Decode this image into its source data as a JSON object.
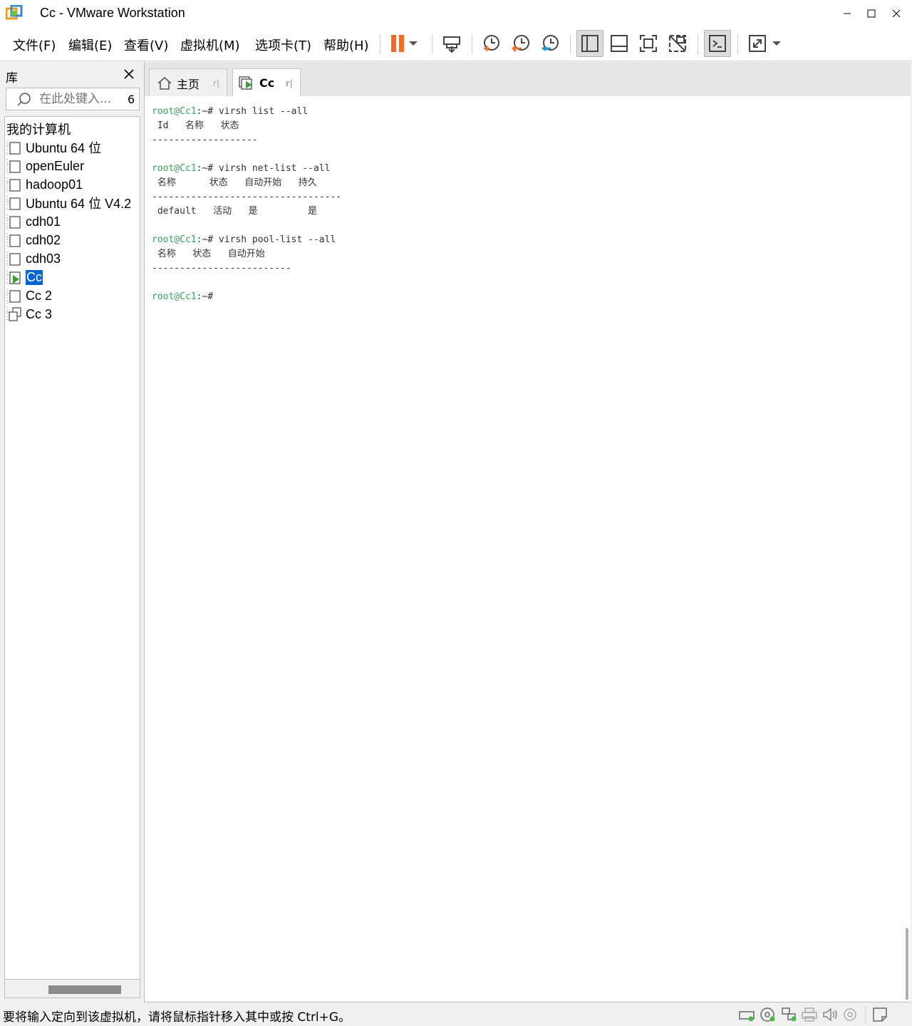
{
  "window": {
    "title": "Cc - VMware Workstation"
  },
  "menu": [
    "文件(F)",
    "编辑(E)",
    "查看(V)",
    "虚拟机(M)",
    "选项卡(T)",
    "帮助(H)"
  ],
  "toolbar": {
    "icons": [
      "pause-icon",
      "dropdown-icon",
      "send-ctrl-alt-del-icon",
      "snapshot-take-icon",
      "snapshot-revert-icon",
      "snapshot-manager-icon",
      "show-library-icon",
      "show-thumbnail-bar-icon",
      "fullscreen-icon",
      "unity-icon",
      "console-view-icon",
      "stretch-icon",
      "dropdown-icon"
    ],
    "accent_pause": "#ef6c25"
  },
  "library": {
    "title": "库",
    "search_placeholder": "在此处键入...",
    "search_badge": "6",
    "root": "我的计算机",
    "items": [
      {
        "label": "Ubuntu 64 位",
        "state": "off"
      },
      {
        "label": "openEuler",
        "state": "off"
      },
      {
        "label": "hadoop01",
        "state": "off"
      },
      {
        "label": "Ubuntu 64 位 V4.2",
        "state": "off"
      },
      {
        "label": "cdh01",
        "state": "off"
      },
      {
        "label": "cdh02",
        "state": "off"
      },
      {
        "label": "cdh03",
        "state": "off"
      },
      {
        "label": "Cc",
        "state": "running",
        "selected": true
      },
      {
        "label": "Cc 2",
        "state": "off"
      },
      {
        "label": "Cc 3",
        "state": "clone"
      }
    ]
  },
  "tabs": [
    {
      "label": "主页",
      "icon": "home-icon",
      "active": false
    },
    {
      "label": "Cc",
      "icon": "vm-running-icon",
      "active": true
    }
  ],
  "terminal": {
    "prompt": "root@Cc1",
    "lines": [
      {
        "prompt": "root@Cc1",
        "rest": ":~# virsh list --all"
      },
      {
        "text": " Id   名称   状态"
      },
      {
        "text": "-------------------"
      },
      {
        "text": ""
      },
      {
        "prompt": "root@Cc1",
        "rest": ":~# virsh net-list --all"
      },
      {
        "text": " 名称      状态   自动开始   持久"
      },
      {
        "text": "----------------------------------"
      },
      {
        "text": " default   活动   是         是"
      },
      {
        "text": ""
      },
      {
        "prompt": "root@Cc1",
        "rest": ":~# virsh pool-list --all"
      },
      {
        "text": " 名称   状态   自动开始"
      },
      {
        "text": "-------------------------"
      },
      {
        "text": ""
      },
      {
        "prompt": "root@Cc1",
        "rest": ":~#"
      }
    ]
  },
  "status": {
    "text": "要将输入定向到该虚拟机，请将鼠标指针移入其中或按 Ctrl+G。",
    "icons": [
      "hard-disk-icon",
      "cd-dvd-icon",
      "network-adapter-icon",
      "printer-icon",
      "sound-icon",
      "usb-icon",
      "message-log-icon"
    ]
  }
}
